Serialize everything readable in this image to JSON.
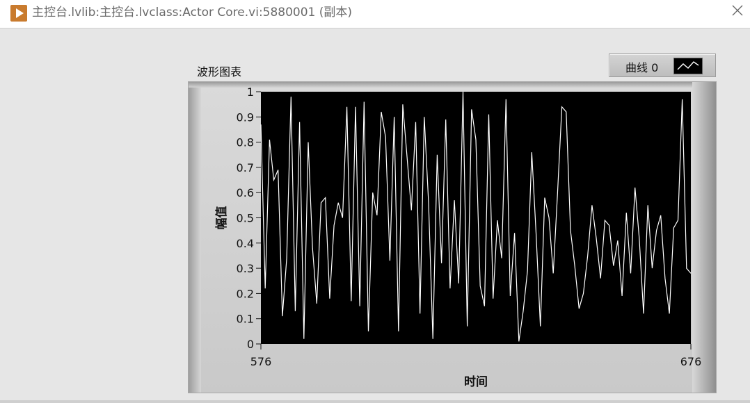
{
  "window": {
    "title": "主控台.lvlib:主控台.lvclass:Actor Core.vi:5880001 (副本)",
    "icons": {
      "app": "labview-run-icon",
      "close": "close-icon"
    }
  },
  "chart": {
    "label": "波形图表",
    "legend": {
      "plot_name": "曲线 0",
      "icon": "plot-line-swatch-icon"
    }
  },
  "colors": {
    "plot_background": "#000000",
    "plot_line": "#ffffff",
    "panel_background": "#e6e6e6",
    "app_icon": "#c97b2e"
  },
  "chart_data": {
    "type": "line",
    "xlabel": "时间",
    "ylabel": "幅值",
    "xlim": [
      576,
      676
    ],
    "ylim": [
      0,
      1
    ],
    "x_ticks": [
      "576",
      "676"
    ],
    "y_ticks": [
      "0",
      "0.1",
      "0.2",
      "0.3",
      "0.4",
      "0.5",
      "0.6",
      "0.7",
      "0.8",
      "0.9",
      "1"
    ],
    "grid": false,
    "series": [
      {
        "x_start": 576,
        "x_step": 1,
        "values": [
          0.87,
          0.22,
          0.81,
          0.65,
          0.69,
          0.11,
          0.34,
          0.98,
          0.13,
          0.88,
          0.02,
          0.8,
          0.38,
          0.16,
          0.56,
          0.58,
          0.18,
          0.47,
          0.56,
          0.5,
          0.94,
          0.17,
          0.94,
          0.15,
          0.96,
          0.05,
          0.6,
          0.51,
          0.92,
          0.82,
          0.33,
          0.9,
          0.05,
          0.95,
          0.74,
          0.53,
          0.88,
          0.12,
          0.9,
          0.56,
          0.02,
          0.75,
          0.32,
          0.89,
          0.22,
          0.57,
          0.24,
          1.0,
          0.07,
          0.93,
          0.81,
          0.23,
          0.15,
          0.91,
          0.18,
          0.49,
          0.34,
          0.97,
          0.19,
          0.44,
          0.01,
          0.13,
          0.29,
          0.76,
          0.44,
          0.07,
          0.58,
          0.5,
          0.28,
          0.6,
          0.94,
          0.92,
          0.45,
          0.31,
          0.14,
          0.2,
          0.35,
          0.55,
          0.42,
          0.26,
          0.49,
          0.47,
          0.31,
          0.41,
          0.19,
          0.52,
          0.28,
          0.62,
          0.42,
          0.12,
          0.55,
          0.3,
          0.45,
          0.51,
          0.26,
          0.12,
          0.46,
          0.49,
          0.97,
          0.3,
          0.28
        ]
      }
    ]
  }
}
